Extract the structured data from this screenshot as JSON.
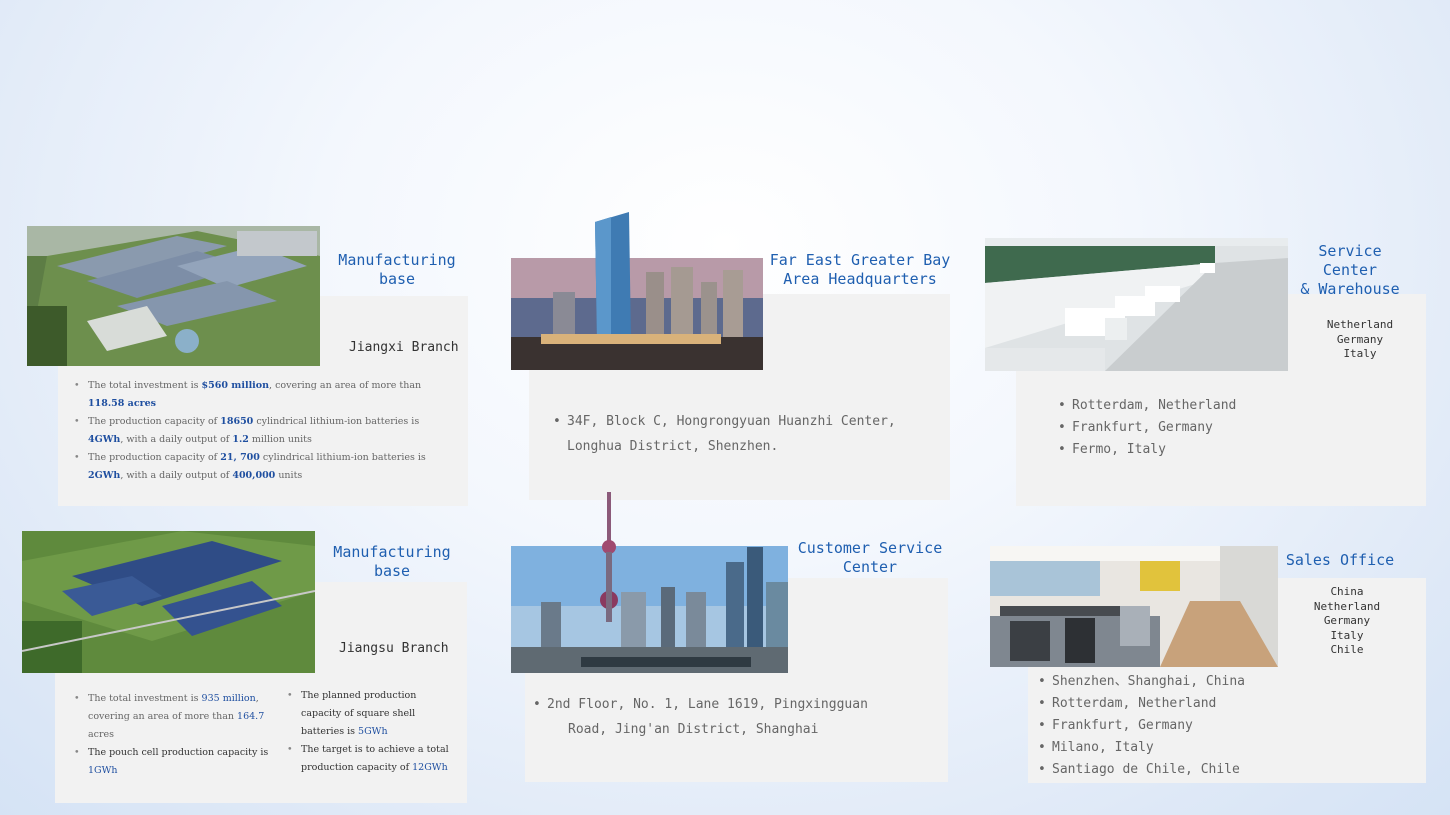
{
  "jiangxi": {
    "title": "Manufacturing base",
    "branch": "Jiangxi Branch",
    "bullets": [
      {
        "pre": "The total investment is ",
        "h1": "$560 million",
        "mid": ", covering an area of more than ",
        "h2": "118.58 acres",
        "post": ""
      },
      {
        "pre": "The production capacity of ",
        "h1": "18650",
        "mid": " cylindrical lithium-ion batteries is ",
        "h2": "4GWh",
        "post": ", with a daily output of ",
        "h3": "1.2",
        "post2": " million units"
      },
      {
        "pre": "The production capacity of ",
        "h1": "21, 700",
        "mid": " cylindrical lithium-ion batteries is ",
        "h2": "2GWh",
        "post": ", with a daily output of ",
        "h3": "400,000",
        "post2": " units"
      }
    ]
  },
  "jiangsu": {
    "title": "Manufacturing base",
    "branch": "Jiangsu Branch",
    "left": [
      {
        "pre": "The total investment is ",
        "h1": "935 million",
        "mid": ", covering an area of more than ",
        "h2": "164.7",
        "post": " acres"
      },
      {
        "pre": "The pouch cell production capacity is ",
        "h1": "1GWh"
      }
    ],
    "right": [
      {
        "pre": "The planned production capacity of square shell batteries is ",
        "h1": "5GWh"
      },
      {
        "pre": "The target is to achieve a total production capacity of ",
        "h1": "12GWh"
      }
    ]
  },
  "hq": {
    "title_line1": "Far East Greater Bay",
    "title_line2": "Area Headquarters",
    "address_line1": "34F, Block C, Hongrongyuan Huanzhi Center,",
    "address_line2": "Longhua District, Shenzhen."
  },
  "csc": {
    "title_line1": "Customer Service",
    "title_line2": "Center",
    "address_line1": "2nd Floor, No. 1, Lane 1619, Pingxingguan",
    "address_line2": "Road, Jing'an District, Shanghai"
  },
  "warehouse": {
    "title_line1": "Service Center",
    "title_line2": "& Warehouse",
    "countries": [
      "Netherland",
      "Germany",
      "Italy"
    ],
    "locations": [
      "Rotterdam, Netherland",
      "Frankfurt, Germany",
      "Fermo, Italy"
    ]
  },
  "sales": {
    "title": "Sales Office",
    "countries": [
      "China",
      "Netherland",
      "Germany",
      "Italy",
      "Chile"
    ],
    "locations": [
      "Shenzhen、Shanghai, China",
      "Rotterdam, Netherland",
      "Frankfurt, Germany",
      "Milano, Italy",
      "Santiago de Chile, Chile"
    ]
  },
  "colors": {
    "accent": "#1f5fb0",
    "panel": "#f2f2f2"
  }
}
